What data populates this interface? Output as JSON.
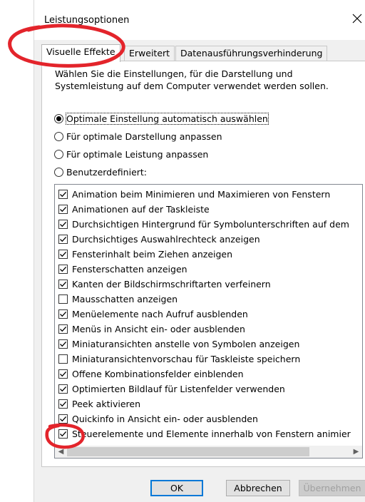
{
  "window": {
    "title": "Leistungsoptionen"
  },
  "tabs": [
    {
      "label": "Visuelle Effekte",
      "active": true
    },
    {
      "label": "Erweitert",
      "active": false
    },
    {
      "label": "Datenausführungsverhinderung",
      "active": false
    }
  ],
  "panel": {
    "description": "Wählen Sie die Einstellungen, für die Darstellung und Systemleistung auf dem Computer verwendet werden sollen.",
    "radios": [
      {
        "label": "Optimale Einstellung automatisch auswählen",
        "checked": true
      },
      {
        "label": "Für optimale Darstellung anpassen",
        "checked": false
      },
      {
        "label": "Für optimale Leistung anpassen",
        "checked": false
      },
      {
        "label": "Benutzerdefiniert:",
        "checked": false
      }
    ],
    "options": [
      {
        "label": "Animation beim Minimieren und Maximieren von Fenstern",
        "checked": true
      },
      {
        "label": "Animationen auf der Taskleiste",
        "checked": true
      },
      {
        "label": "Durchsichtigen Hintergrund für Symbolunterschriften auf dem",
        "checked": true
      },
      {
        "label": "Durchsichtiges Auswahlrechteck anzeigen",
        "checked": true
      },
      {
        "label": "Fensterinhalt beim Ziehen anzeigen",
        "checked": true
      },
      {
        "label": "Fensterschatten anzeigen",
        "checked": true
      },
      {
        "label": "Kanten der Bildschirmschriftarten verfeinern",
        "checked": true
      },
      {
        "label": "Mausschatten anzeigen",
        "checked": false
      },
      {
        "label": "Menüelemente nach Aufruf ausblenden",
        "checked": true
      },
      {
        "label": "Menüs in Ansicht ein- oder ausblenden",
        "checked": true
      },
      {
        "label": "Miniaturansichten anstelle von Symbolen anzeigen",
        "checked": true
      },
      {
        "label": "Miniaturansichtenvorschau für Taskleiste speichern",
        "checked": false
      },
      {
        "label": "Offene Kombinationsfelder einblenden",
        "checked": true
      },
      {
        "label": "Optimierten Bildlauf für Listenfelder verwenden",
        "checked": true
      },
      {
        "label": "Peek aktivieren",
        "checked": true
      },
      {
        "label": "Quickinfo in Ansicht ein- oder ausblenden",
        "checked": true
      },
      {
        "label": "Steuerelemente und Elemente innerhalb von Fenstern animier",
        "checked": true
      }
    ]
  },
  "buttons": {
    "ok": "OK",
    "cancel": "Abbrechen",
    "apply": "Übernehmen"
  },
  "colors": {
    "accent": "#0078d7",
    "annotation": "#e3242b"
  }
}
